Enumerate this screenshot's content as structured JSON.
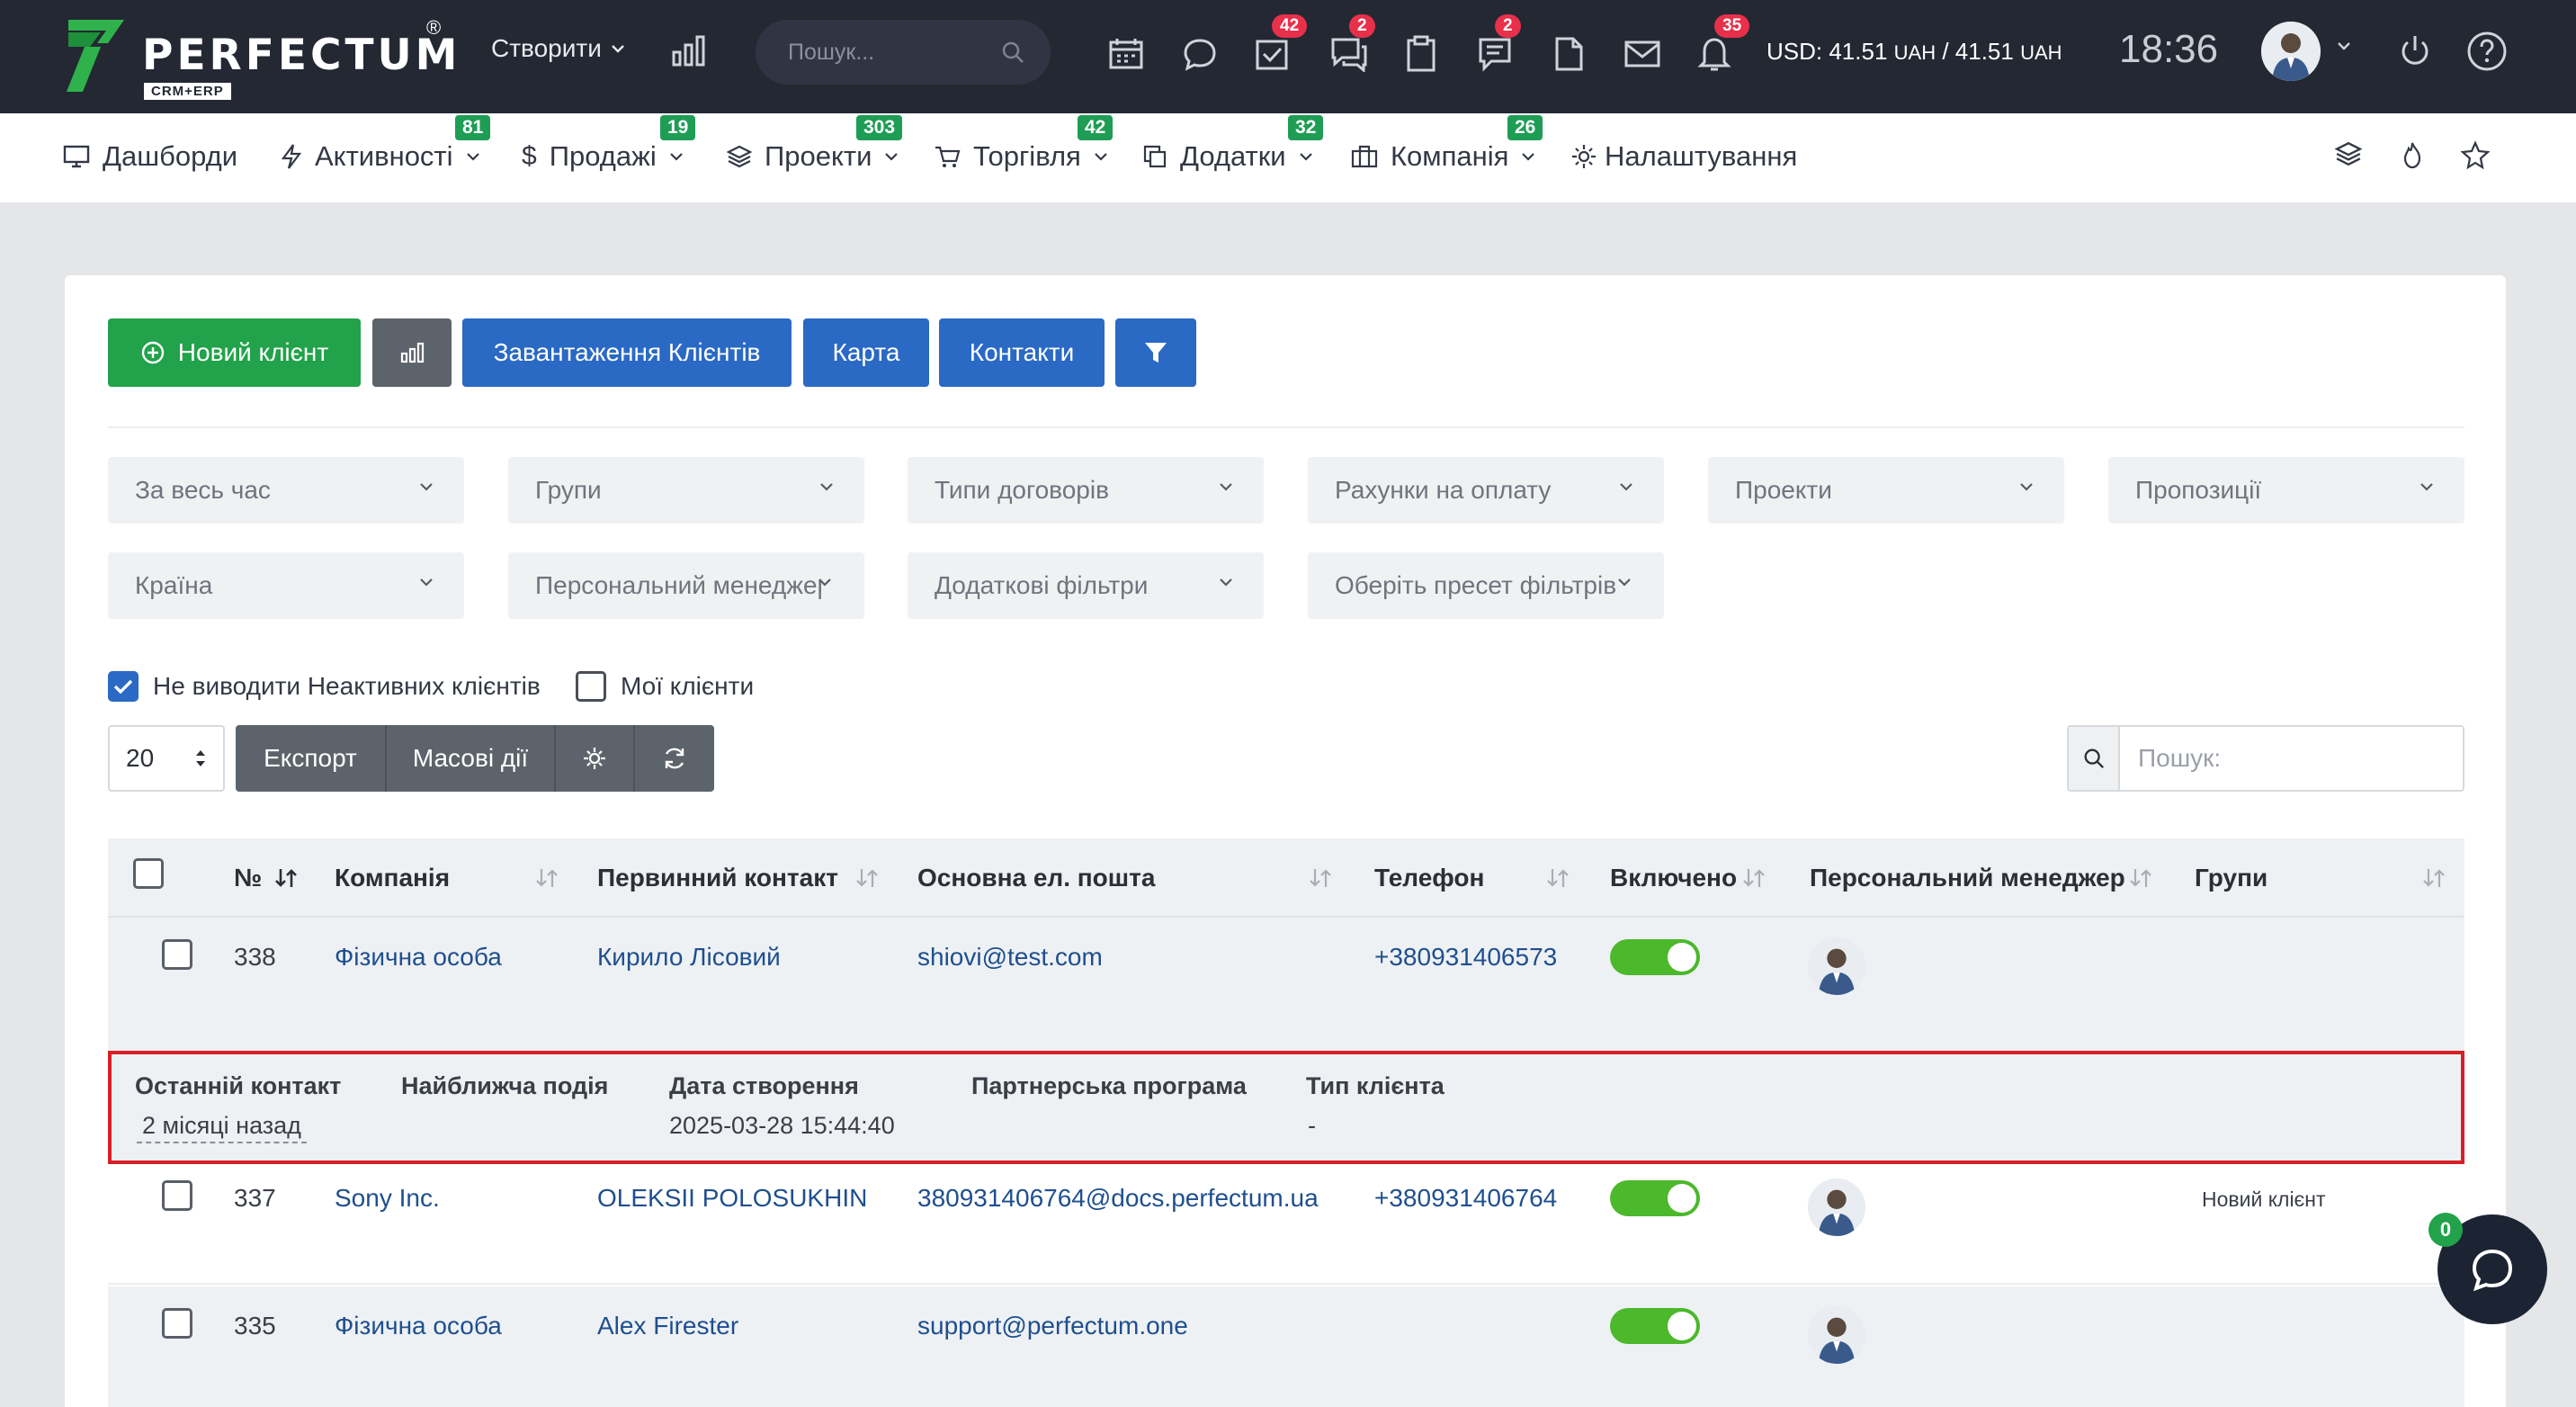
{
  "brand": {
    "name": "PERFECTUM",
    "sub": "CRM+ERP",
    "reg": "®"
  },
  "topbar": {
    "create_label": "Створити",
    "search_placeholder": "Пошук...",
    "badges": {
      "tasks": "42",
      "discussions": "2",
      "notes": "2",
      "notifications": "35"
    },
    "currency": {
      "prefix": "USD: 41.51",
      "unit1": "UAH",
      "sep": "/ 41.51",
      "unit2": "UAH"
    },
    "time": "18:36"
  },
  "nav": [
    {
      "label": "Дашборди",
      "icon": "monitor-icon"
    },
    {
      "label": "Активності",
      "badge": "81",
      "icon": "lightning-icon"
    },
    {
      "label": "Продажі",
      "badge": "19",
      "icon": "dollar-icon"
    },
    {
      "label": "Проекти",
      "badge": "303",
      "icon": "layers-icon"
    },
    {
      "label": "Торгівля",
      "badge": "42",
      "icon": "cart-icon"
    },
    {
      "label": "Додатки",
      "badge": "32",
      "icon": "copy-icon"
    },
    {
      "label": "Компанія",
      "badge": "26",
      "icon": "briefcase-icon"
    },
    {
      "label": "Налаштування",
      "icon": "gear-icon"
    }
  ],
  "toolbar": {
    "new_client": "Новий клієнт",
    "upload_clients": "Завантаження Клієнтів",
    "map": "Карта",
    "contacts": "Контакти"
  },
  "filters": {
    "row1": [
      "За весь час",
      "Групи",
      "Типи договорів",
      "Рахунки на оплату",
      "Проекти",
      "Пропозиції"
    ],
    "row2": [
      "Країна",
      "Персональний менеджер",
      "Додаткові фільтри",
      "Оберіть пресет фільтрів"
    ]
  },
  "checkboxes": {
    "hide_inactive": "Не виводити Неактивних клієнтів",
    "my_clients": "Мої клієнти"
  },
  "table_controls": {
    "per_page": "20",
    "export": "Експорт",
    "bulk": "Масові дії",
    "search_placeholder": "Пошук:"
  },
  "table": {
    "headers": [
      "№",
      "Компанія",
      "Первинний контакт",
      "Основна ел. пошта",
      "Телефон",
      "Включено",
      "Персональний менеджер",
      "Групи"
    ],
    "rows": [
      {
        "id": "338",
        "company": "Фізична особа",
        "contact": "Кирило Лісовий",
        "email": "shiovi@test.com",
        "phone": "+380931406573",
        "enabled": true,
        "groups": ""
      },
      {
        "id": "337",
        "company": "Sony Inc.",
        "contact": "OLEKSII POLOSUKHIN",
        "email": "380931406764@docs.perfectum.ua",
        "phone": "+380931406764",
        "enabled": true,
        "groups": "Новий клієнт"
      },
      {
        "id": "335",
        "company": "Фізична особа",
        "contact": "Alex Firester",
        "email": "support@perfectum.one",
        "phone": "",
        "enabled": true,
        "groups": ""
      }
    ]
  },
  "detail": {
    "headers": [
      "Останній контакт",
      "Найближча подія",
      "Дата створення",
      "Партнерська програма",
      "Тип клієнта"
    ],
    "last_contact": "2 місяці назад",
    "next_event": "",
    "created": "2025-03-28 15:44:40",
    "partner": "",
    "client_type": "-"
  },
  "chat": {
    "badge": "0"
  },
  "colors": {
    "topbar": "#232833",
    "green": "#22a24a",
    "blue": "#2a69c4",
    "highlight": "#d81f26"
  }
}
